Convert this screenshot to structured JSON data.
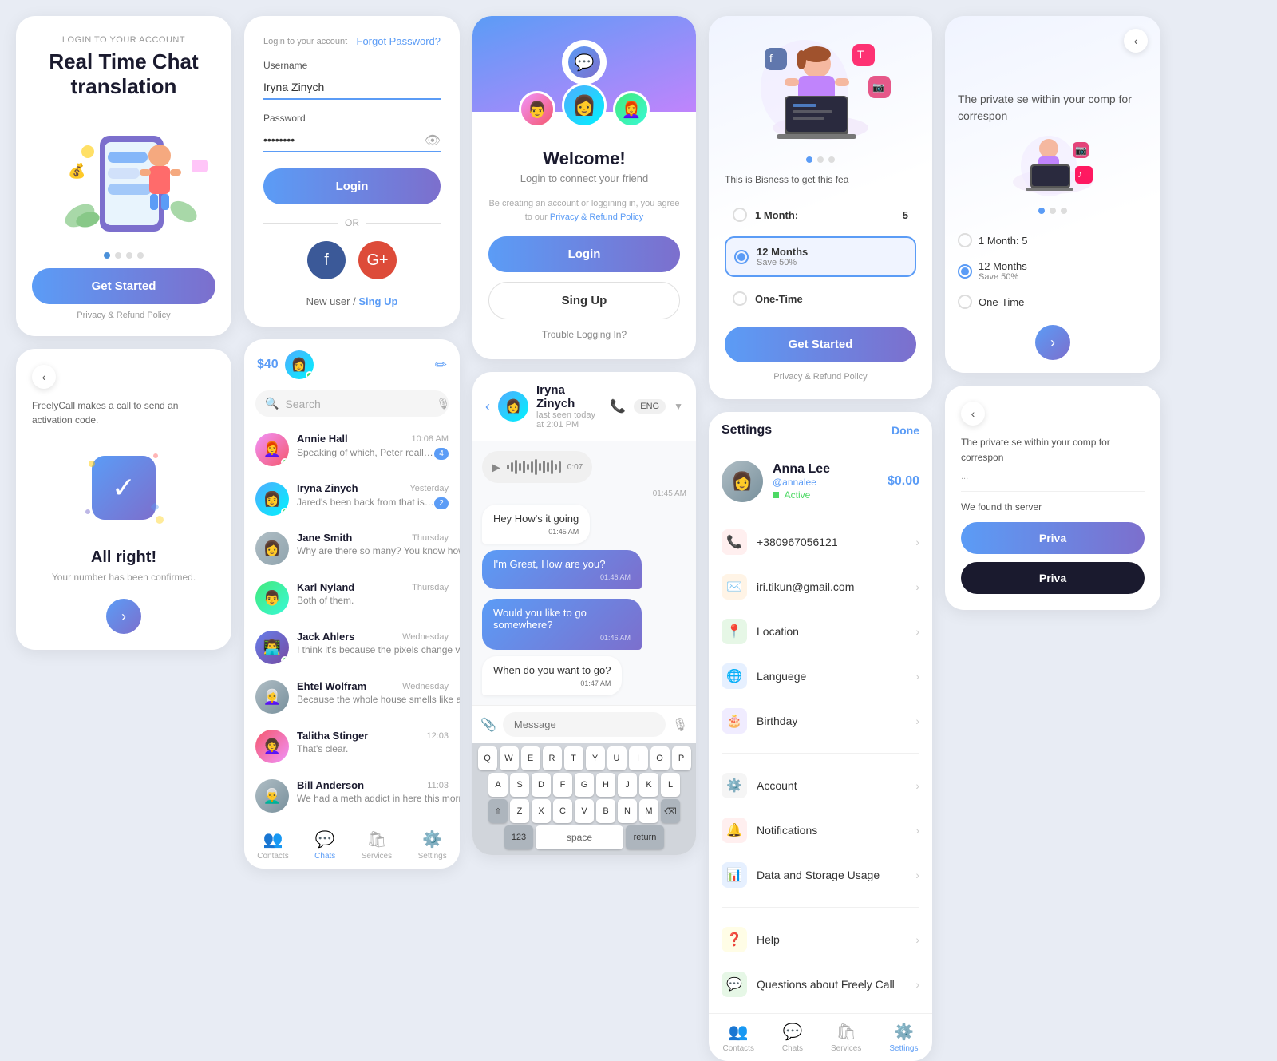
{
  "col1": {
    "card_onboard": {
      "subtitle": "Login to your account",
      "title": "Real Time Chat translation",
      "get_started": "Get Started",
      "privacy": "Privacy & Refund Policy"
    },
    "card_verify": {
      "back": "‹",
      "verify_text": "FreelyCall makes a call to send an activation code.",
      "title": "All right!",
      "subtitle": "Your number has been confirmed."
    }
  },
  "col2": {
    "card_login": {
      "header": "Login to your account",
      "forgot": "Forgot Password?",
      "username_label": "Username",
      "username_value": "Iryna Zinych",
      "password_label": "Password",
      "password_value": "••••••••",
      "login_btn": "Login",
      "or": "OR",
      "new_user": "New user /",
      "sign_up": "Sing Up"
    },
    "card_chat_list": {
      "balance": "$40",
      "search_placeholder": "Search",
      "compose": "✏",
      "chats": [
        {
          "name": "Annie Hall",
          "time": "10:08 AM",
          "preview": "Speaking of which, Peter really wants you to come in on Friday...",
          "unread": 4,
          "online": true
        },
        {
          "name": "Iryna Zinych",
          "time": "Yesterday",
          "preview": "Jared's been back from that island for a whole day and...",
          "unread": 2,
          "online": true
        },
        {
          "name": "Jane Smith",
          "time": "Thursday",
          "preview": "Why are there so many? You know how sea turtles have...",
          "unread": 0,
          "online": false
        },
        {
          "name": "Karl Nyland",
          "time": "Thursday",
          "preview": "Both of them.",
          "unread": 0,
          "online": false
        },
        {
          "name": "Jack Ahlers",
          "time": "Wednesday",
          "preview": "I think it's because the pixels change value differently",
          "unread": 0,
          "online": true
        },
        {
          "name": "Ehtel Wolfram",
          "time": "Wednesday",
          "preview": "Because the whole house smells like a bait station.",
          "unread": 0,
          "online": false
        },
        {
          "name": "Talitha Stinger",
          "time": "12:03",
          "preview": "That's clear.",
          "unread": 0,
          "online": false
        },
        {
          "name": "Bill Anderson",
          "time": "11:03",
          "preview": "We had a meth addict in here this morning who was biologically younger...",
          "unread": 0,
          "online": false
        }
      ],
      "nav": [
        "Contacts",
        "Chats",
        "Services",
        "Settings"
      ]
    }
  },
  "col3": {
    "card_welcome": {
      "title": "Welcome!",
      "subtitle": "Login to connect your friend",
      "terms": "Be creating an account or loggining in, you agree to our",
      "terms_link": "Privacy & Refund Policy",
      "login_btn": "Login",
      "signup_btn": "Sing Up",
      "trouble": "Trouble Logging In?"
    },
    "card_conv": {
      "user": "Iryna Zinych",
      "status": "last seen today at 2:01 PM",
      "lang": "ENG",
      "messages": [
        {
          "type": "audio",
          "duration": "0:07",
          "time": "01:45 AM"
        },
        {
          "type": "received",
          "text": "Hey How's it going",
          "time": "01:45 AM"
        },
        {
          "type": "sent",
          "text": "I'm Great, How are you?",
          "time": "01:46 AM"
        },
        {
          "type": "sent",
          "text": "Would you like to go somewhere?",
          "time": "01:46 AM"
        },
        {
          "type": "received",
          "text": "When do you want to go?",
          "time": "01:47 AM"
        }
      ],
      "input_placeholder": "Message",
      "keyboard_rows": [
        [
          "Q",
          "W",
          "E",
          "R",
          "T",
          "Y",
          "U",
          "I",
          "O",
          "P"
        ],
        [
          "A",
          "S",
          "D",
          "F",
          "G",
          "H",
          "J",
          "K",
          "L"
        ],
        [
          "⇧",
          "Z",
          "X",
          "C",
          "V",
          "B",
          "N",
          "M",
          "⌫"
        ],
        [
          "123",
          "space",
          "return"
        ]
      ]
    }
  },
  "col4": {
    "card_sub": {
      "description": "This is Bisness to get this fea",
      "options": [
        {
          "label": "1 Month:",
          "detail": "",
          "price": "5",
          "selected": false
        },
        {
          "label": "12 Months",
          "detail": "Save 50%",
          "price": "",
          "selected": true
        },
        {
          "label": "One-Time",
          "detail": "",
          "price": "",
          "selected": false
        }
      ],
      "btn": "Get Started",
      "privacy": "Privacy & Refund Policy"
    },
    "card_settings": {
      "title": "Settings",
      "done": "Done",
      "profile": {
        "name": "Anna Lee",
        "handle": "@annalee",
        "status": "Active",
        "balance": "$0.00"
      },
      "items": [
        {
          "icon": "📞",
          "color": "#ff3b30",
          "label": "+380967056121",
          "value": ""
        },
        {
          "icon": "✉️",
          "color": "#ff9500",
          "label": "iri.tikun@gmail.com",
          "value": ""
        },
        {
          "icon": "📍",
          "color": "#4cd964",
          "label": "Location",
          "value": ""
        },
        {
          "icon": "🌐",
          "color": "#5b9cf6",
          "label": "Languege",
          "value": ""
        },
        {
          "icon": "🎂",
          "color": "#7c6fcd",
          "label": "Birthday",
          "value": ""
        },
        {
          "icon": "⚙️",
          "color": "#8e8e93",
          "label": "Account",
          "value": ""
        },
        {
          "icon": "🔔",
          "color": "#ff3b30",
          "label": "Notifications",
          "value": ""
        },
        {
          "icon": "📊",
          "color": "#5b9cf6",
          "label": "Data and Storage Usage",
          "value": ""
        },
        {
          "icon": "❓",
          "color": "#ffcc00",
          "label": "Help",
          "value": ""
        },
        {
          "icon": "💬",
          "color": "#4cd964",
          "label": "Questions about Freely Call",
          "value": ""
        }
      ],
      "nav": [
        "Contacts",
        "Chats",
        "Services",
        "Settings"
      ]
    }
  },
  "col5": {
    "card_private1": {
      "back": "‹",
      "title": "The private se within your comp for correspon",
      "options": [
        {
          "label": "1 Month: 5",
          "selected": false
        },
        {
          "label": "12 Months Save 50%",
          "selected": true
        },
        {
          "label": "One-Time",
          "selected": false
        }
      ],
      "btn": "▶"
    },
    "card_private2": {
      "back": "‹",
      "content": "The private se within your comp for correspon",
      "more": "...",
      "server_text": "We found th server",
      "btn1": "Priva",
      "btn2": "Priva"
    }
  }
}
